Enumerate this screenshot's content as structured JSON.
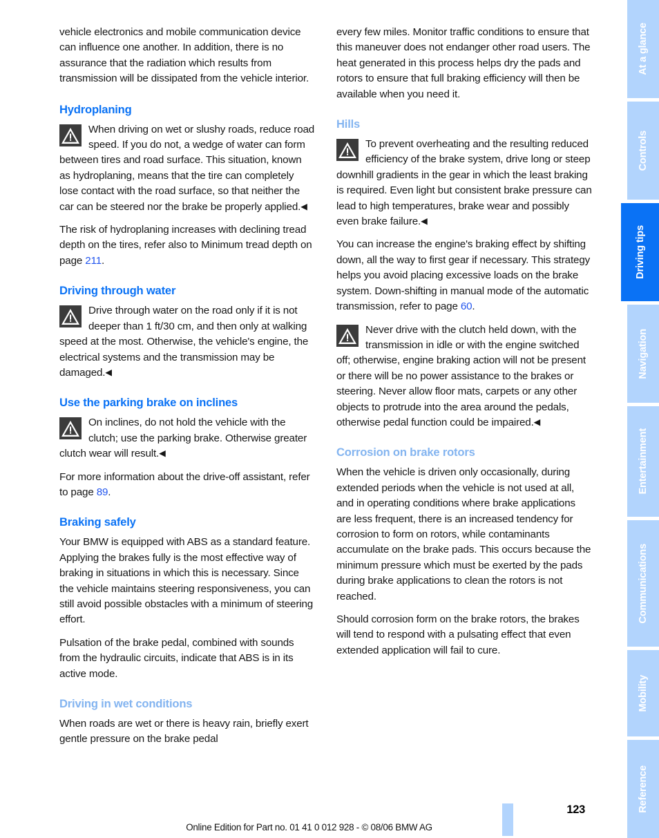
{
  "document": {
    "page_number": "123",
    "footer_note": "Online Edition for Part no. 01 41 0 012 928 - © 08/06 BMW AG"
  },
  "sidebar": {
    "tabs": [
      {
        "label": "At a glance",
        "active": false
      },
      {
        "label": "Controls",
        "active": false
      },
      {
        "label": "Driving tips",
        "active": true
      },
      {
        "label": "Navigation",
        "active": false
      },
      {
        "label": "Entertainment",
        "active": false
      },
      {
        "label": "Communications",
        "active": false
      },
      {
        "label": "Mobility",
        "active": false
      },
      {
        "label": "Reference",
        "active": false
      }
    ]
  },
  "colors": {
    "heading_blue": "#0a72f5",
    "subheading_blue": "#83b4f0",
    "tab_inactive": "#b2d4fd",
    "tab_active": "#0a72f5",
    "link_blue": "#2255ee",
    "warning_icon_bg": "#3b3b3b"
  },
  "left_column": {
    "continued_paragraph": "vehicle electronics and mobile communication device can influence one another. In addition, there is no assurance that the radiation which results from transmission will be dissipated from the vehicle interior.",
    "hydroplaning": {
      "heading": "Hydroplaning",
      "warning": "When driving on wet or slushy roads, reduce road speed. If you do not, a wedge of water can form between tires and road surface. This situation, known as hydroplaning, means that the tire can completely lose contact with the road surface, so that neither the car can be steered nor the brake be properly applied.",
      "paragraph_pre": "The risk of hydroplaning increases with declining tread depth on the tires, refer also to Minimum tread depth on page ",
      "paragraph_link": "211",
      "paragraph_post": "."
    },
    "driving_through_water": {
      "heading": "Driving through water",
      "warning": "Drive through water on the road only if it is not deeper than 1 ft/30 cm, and then only at walking speed at the most. Otherwise, the vehicle's engine, the electrical systems and the transmission may be damaged."
    },
    "parking_brake": {
      "heading": "Use the parking brake on inclines",
      "warning": "On inclines, do not hold the vehicle with the clutch; use the parking brake. Otherwise greater clutch wear will result.",
      "paragraph_pre": "For more information about the drive-off assistant, refer to page ",
      "paragraph_link": "89",
      "paragraph_post": "."
    },
    "braking_safely": {
      "heading": "Braking safely",
      "paragraph_1": "Your BMW is equipped with ABS as a standard feature. Applying the brakes fully is the most effective way of braking in situations in which this is necessary. Since the vehicle maintains steering responsiveness, you can still avoid possible obstacles with a minimum of steering effort.",
      "paragraph_2": "Pulsation of the brake pedal, combined with sounds from the hydraulic circuits, indicate that ABS is in its active mode."
    },
    "wet_conditions": {
      "heading": "Driving in wet conditions",
      "paragraph_1": "When roads are wet or there is heavy rain, briefly exert gentle pressure on the brake pedal"
    }
  },
  "right_column": {
    "continued_paragraph": "every few miles. Monitor traffic conditions to ensure that this maneuver does not endanger other road users. The heat generated in this process helps dry the pads and rotors to ensure that full braking efficiency will then be available when you need it.",
    "hills": {
      "heading": "Hills",
      "warning": "To prevent overheating and the resulting reduced efficiency of the brake system, drive long or steep downhill gradients in the gear in which the least braking is required. Even light but consistent brake pressure can lead to high temperatures, brake wear and possibly even brake failure.",
      "paragraph_pre": "You can increase the engine's braking effect by shifting down, all the way to first gear if necessary. This strategy helps you avoid placing excessive loads on the brake system. Down-shifting in manual mode of the automatic transmission, refer to page ",
      "paragraph_link": "60",
      "paragraph_post": ".",
      "warning_2": "Never drive with the clutch held down, with the transmission in idle or with the engine switched off; otherwise, engine braking action will not be present or there will be no power assistance to the brakes or steering. Never allow floor mats, carpets or any other objects to protrude into the area around the pedals, otherwise pedal function could be impaired."
    },
    "corrosion": {
      "heading": "Corrosion on brake rotors",
      "paragraph_1": "When the vehicle is driven only occasionally, during extended periods when the vehicle is not used at all, and in operating conditions where brake applications are less frequent, there is an increased tendency for corrosion to form on rotors, while contaminants accumulate on the brake pads. This occurs because the minimum pressure which must be exerted by the pads during brake applications to clean the rotors is not reached.",
      "paragraph_2": "Should corrosion form on the brake rotors, the brakes will tend to respond with a pulsating effect that even extended application will fail to cure."
    }
  },
  "icons": {
    "warning": "warning-triangle-icon",
    "end_marker": "◀"
  }
}
